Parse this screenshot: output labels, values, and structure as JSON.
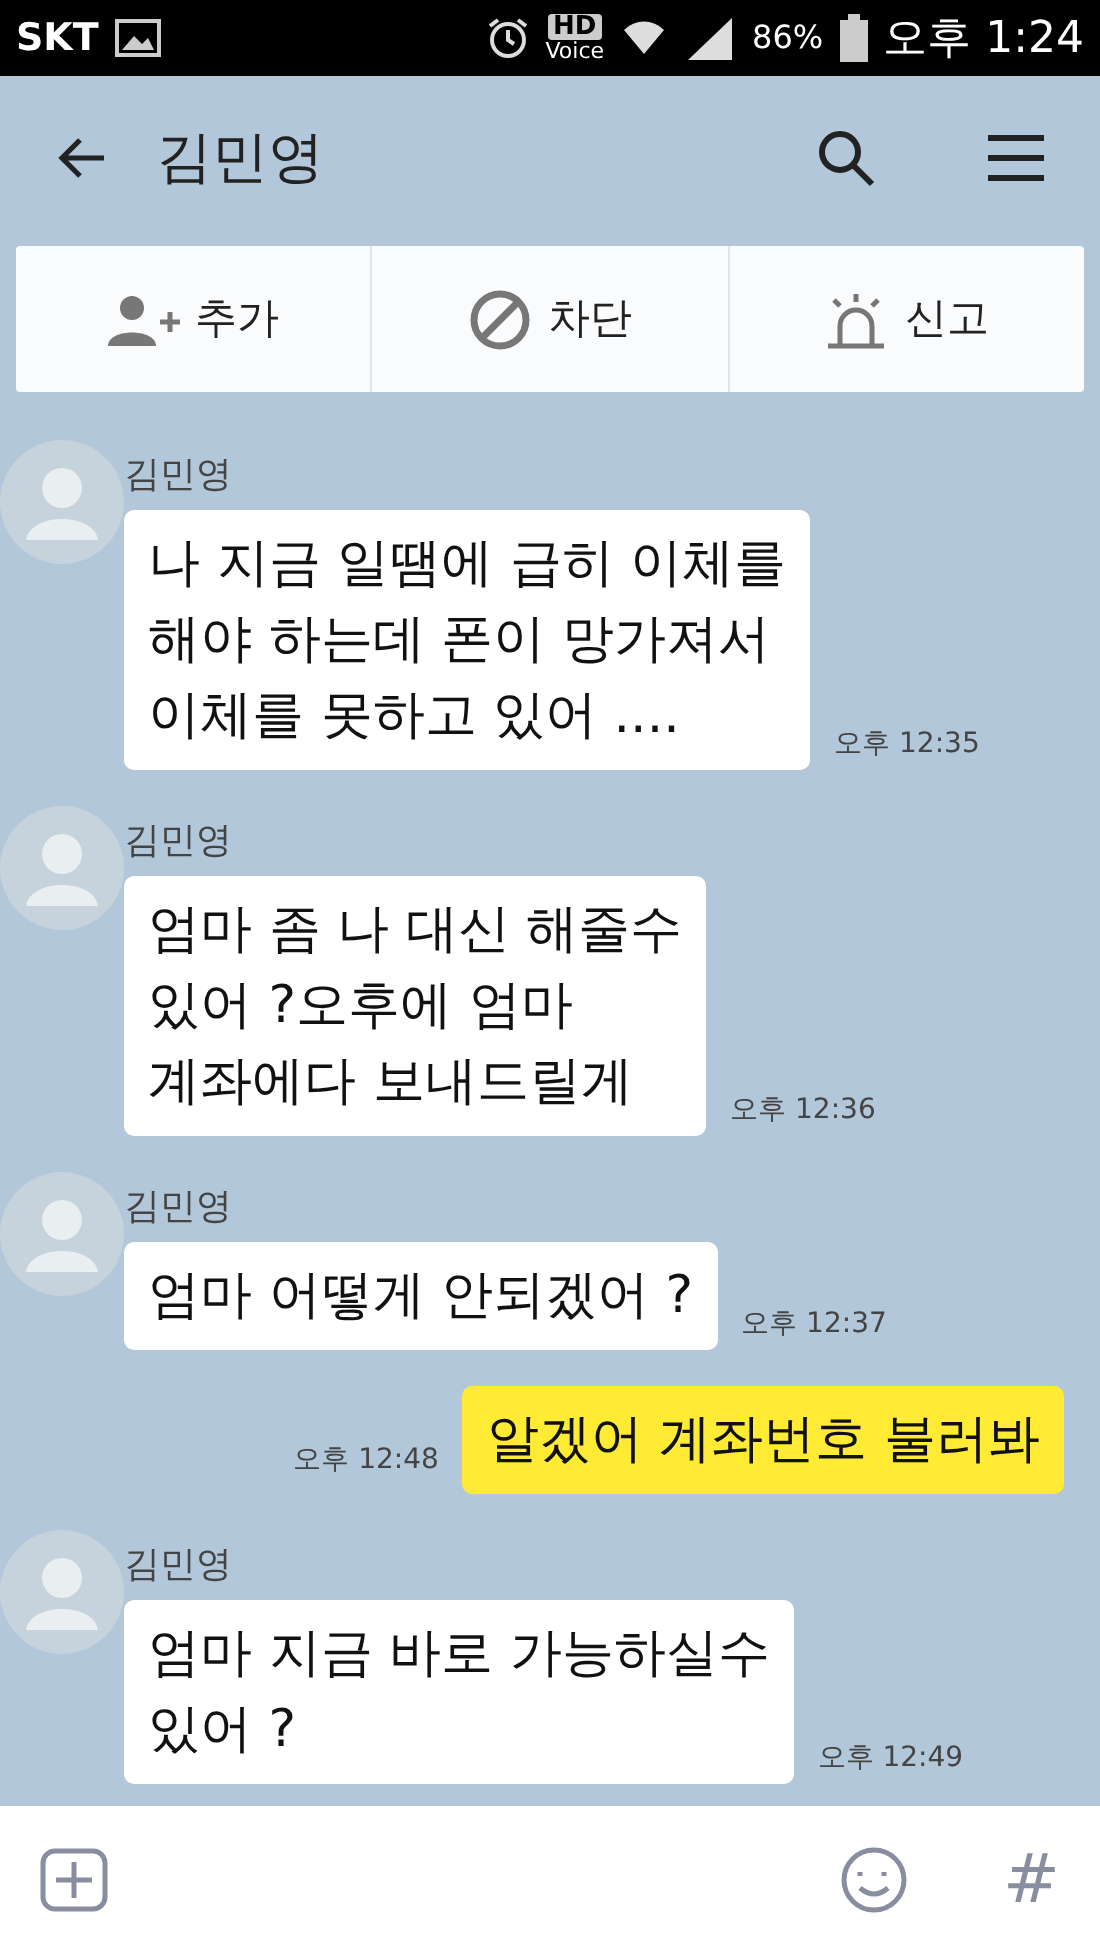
{
  "status_bar": {
    "carrier": "SKT",
    "hd": "HD",
    "voice": "Voice",
    "battery": "86%",
    "time": "오후 1:24"
  },
  "header": {
    "title": "김민영"
  },
  "action_bar": [
    {
      "kind": "add",
      "label": "추가"
    },
    {
      "kind": "block",
      "label": "차단"
    },
    {
      "kind": "report",
      "label": "신고"
    }
  ],
  "messages": [
    {
      "kind": "received",
      "sender": "김민영",
      "text": "나 지금 일땜에 급히 이체를\n해야 하는데 폰이 망가져서\n이체를 못하고 있어 ....",
      "time": "오후 12:35"
    },
    {
      "kind": "received",
      "sender": "김민영",
      "text": "엄마 좀 나 대신 해줄수\n있어 ?오후에 엄마\n계좌에다 보내드릴게",
      "time": "오후 12:36"
    },
    {
      "kind": "received",
      "sender": "김민영",
      "text": "엄마 어떻게 안되겠어 ?",
      "time": "오후 12:37"
    },
    {
      "kind": "sent",
      "text": "알겠어 계좌번호 불러봐",
      "time": "오후 12:48"
    },
    {
      "kind": "received",
      "sender": "김민영",
      "text": "엄마 지금 바로 가능하실수\n있어 ?",
      "time": "오후 12:49"
    }
  ],
  "input_bar": {
    "hash": "#"
  }
}
